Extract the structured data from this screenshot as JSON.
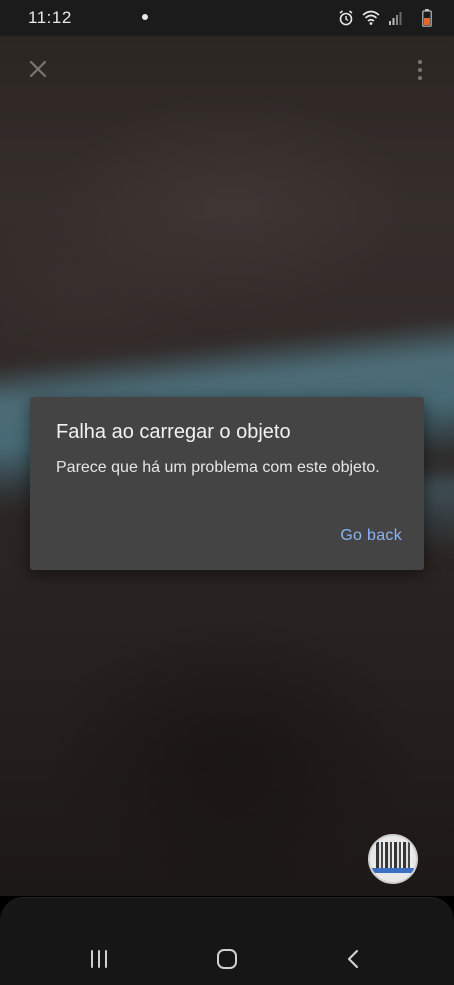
{
  "status_bar": {
    "time": "11:12",
    "icons": [
      "notification-dot",
      "alarm-icon",
      "wifi-icon",
      "signal-icon",
      "battery-icon"
    ]
  },
  "camera": {
    "close_icon": "close-icon",
    "menu_icon": "more-vert-icon"
  },
  "dialog": {
    "title": "Falha ao carregar o objeto",
    "message": "Parece que há um problema com este objeto.",
    "action_label": "Go back"
  },
  "nav_bar": {
    "recents_icon": "recents-icon",
    "home_icon": "home-icon",
    "back_icon": "back-icon"
  },
  "colors": {
    "dialog_bg": "#444444",
    "action_text": "#8ab4f8",
    "status_bar_bg": "#1b1b1b",
    "nav_bar_bg": "#161616"
  }
}
